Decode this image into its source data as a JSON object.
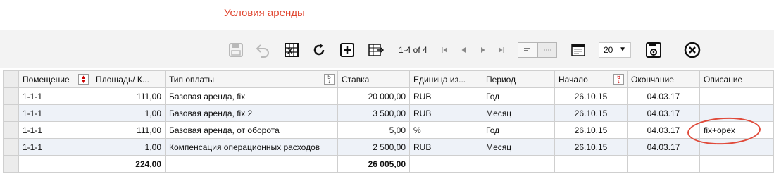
{
  "page": {
    "title": "Условия аренды"
  },
  "toolbar": {
    "pager_text": "1-4 of 4",
    "page_size": "20",
    "icons": [
      "save-icon",
      "undo-icon",
      "excel-icon",
      "refresh-icon",
      "add-icon",
      "export-icon",
      "first-page-icon",
      "prev-page-icon",
      "next-page-icon",
      "last-page-icon",
      "align-icon",
      "line-icon",
      "window-icon",
      "settings-save-icon",
      "close-icon"
    ]
  },
  "grid": {
    "columns": [
      "Помещение",
      "Площадь/ К...",
      "Тип оплаты",
      "Ставка",
      "Единица из...",
      "Период",
      "Начало",
      "Окончание",
      "Описание"
    ],
    "rows": [
      {
        "room": "1-1-1",
        "area": "111,00",
        "type": "Базовая аренда, fix",
        "rate": "20 000,00",
        "unit": "RUB",
        "period": "Год",
        "start": "26.10.15",
        "end": "04.03.17",
        "desc": ""
      },
      {
        "room": "1-1-1",
        "area": "1,00",
        "type": "Базовая аренда, fix 2",
        "rate": "3 500,00",
        "unit": "RUB",
        "period": "Месяц",
        "start": "26.10.15",
        "end": "04.03.17",
        "desc": ""
      },
      {
        "room": "1-1-1",
        "area": "111,00",
        "type": "Базовая аренда, от оборота",
        "rate": "5,00",
        "unit": "%",
        "period": "Год",
        "start": "26.10.15",
        "end": "04.03.17",
        "desc": "fix+opex"
      },
      {
        "room": "1-1-1",
        "area": "1,00",
        "type": "Компенсация операционных расходов",
        "rate": "2 500,00",
        "unit": "RUB",
        "period": "Месяц",
        "start": "26.10.15",
        "end": "04.03.17",
        "desc": ""
      }
    ],
    "totals": {
      "area": "224,00",
      "rate": "26 005,00"
    }
  },
  "colors": {
    "title": "#e0452f",
    "annotation": "#e04a3a",
    "alt_row": "#eef2f8"
  }
}
